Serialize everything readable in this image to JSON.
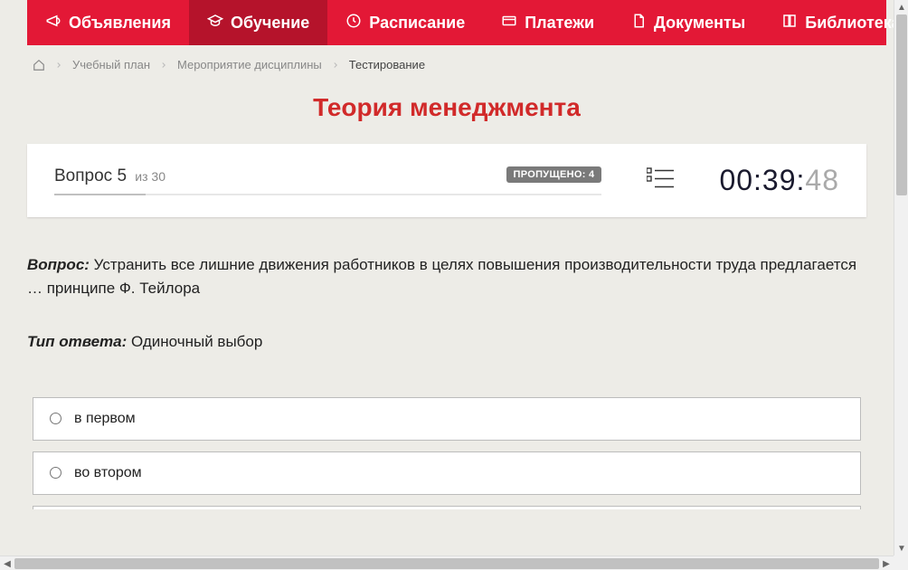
{
  "nav": {
    "items": [
      {
        "label": "Объявления",
        "icon": "megaphone"
      },
      {
        "label": "Обучение",
        "icon": "graduation",
        "active": true
      },
      {
        "label": "Расписание",
        "icon": "clock"
      },
      {
        "label": "Платежи",
        "icon": "card"
      },
      {
        "label": "Документы",
        "icon": "document"
      },
      {
        "label": "Библиотека",
        "icon": "book",
        "dropdown": true
      }
    ]
  },
  "breadcrumb": {
    "items": [
      {
        "label": "Учебный план"
      },
      {
        "label": "Мероприятие дисциплины"
      },
      {
        "label": "Тестирование",
        "current": true
      }
    ]
  },
  "page_title": "Теория менеджмента",
  "question": {
    "number_label": "Вопрос 5",
    "total_label": "из 30",
    "current": 5,
    "total": 30,
    "skipped_label": "ПРОПУЩЕНО: 4",
    "skipped_count": 4
  },
  "timer": {
    "main": "00:39:",
    "ms": "48"
  },
  "body": {
    "question_label": "Вопрос:",
    "question_text": "Устранить все лишние движения работников в целях повышения производительности труда предлагается … принципе Ф. Тейлора",
    "answer_type_label": "Тип ответа:",
    "answer_type_value": "Одиночный выбор"
  },
  "answers": [
    {
      "text": "в первом"
    },
    {
      "text": "во втором"
    }
  ]
}
